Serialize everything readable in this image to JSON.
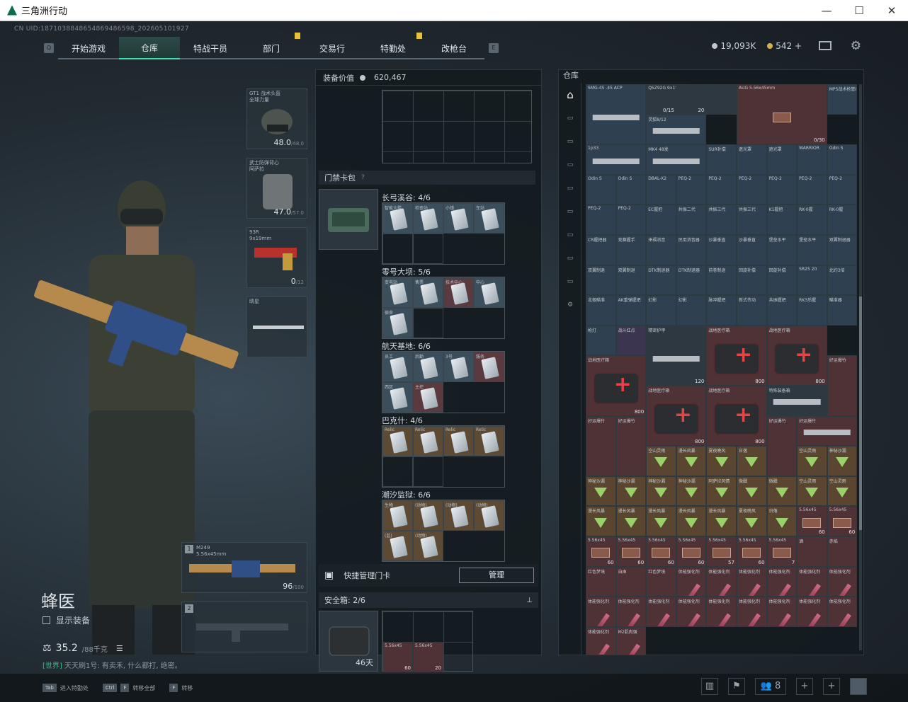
{
  "window": {
    "title": "三角洲行动",
    "minimize": "—",
    "maximize": "☐",
    "close": "✕"
  },
  "uid": "CN UID:1871038848654869486598_202605101927",
  "nav": {
    "tabs": [
      "开始游戏",
      "仓库",
      "特战干员",
      "部门",
      "交易行",
      "特勤处",
      "改枪台"
    ],
    "active": "仓库"
  },
  "currency": {
    "silver": "19,093K",
    "gold": "542",
    "plus": "+"
  },
  "operator": {
    "name": "蜂医",
    "show_gear": "显示装备",
    "weight": "35.2",
    "weight_max": "/88千克",
    "chat_tag": "[世界]",
    "chat_text": "天天刷1号: 有卖禾, 什么都打, 绝密。"
  },
  "gear": {
    "helmet": {
      "label": "GT1 战术头盔\n全球力量",
      "val": "48.0",
      "max": "/48.0"
    },
    "armor": {
      "label": "武士防弹背心\n阿萨拉",
      "val": "47.0",
      "max": "/57.0"
    },
    "pistol": {
      "label": "93R\n9x19mm",
      "val": "0",
      "max": "/12"
    },
    "melee": {
      "label": "晴星"
    },
    "primary": {
      "num": "1",
      "label": "M249\n5.56x45mm",
      "val": "96",
      "max": "/100"
    },
    "secondary": {
      "num": "2"
    }
  },
  "center": {
    "equip_value_label": "装备价值",
    "equip_value": "620,467",
    "cardbag_title": "门禁卡包",
    "maps": [
      {
        "name": "长弓溪谷: 4/6",
        "cards": [
          [
            "智能大楼",
            "blue"
          ],
          [
            "检查站",
            "blue"
          ],
          [
            "小镇",
            "blue"
          ],
          [
            "车站",
            "blue"
          ]
        ]
      },
      {
        "name": "零号大坝: 5/6",
        "cards": [
          [
            "变电站",
            "blue"
          ],
          [
            "售票",
            "blue"
          ],
          [
            "技术中心",
            "red"
          ],
          [
            "中心",
            "blue"
          ],
          [
            "宿舍",
            "blue"
          ]
        ]
      },
      {
        "name": "航天基地: 6/6",
        "cards": [
          [
            "员工",
            "blue"
          ],
          [
            "后勤",
            "blue"
          ],
          [
            "3号",
            "blue"
          ],
          [
            "服务",
            "red"
          ],
          [
            "西区",
            "blue"
          ],
          [
            "主控",
            "red"
          ]
        ]
      },
      {
        "name": "巴克什: 4/6",
        "cards": [
          [
            "Relic",
            "gold"
          ],
          [
            "Relic",
            "gold"
          ],
          [
            "Relic",
            "gold"
          ],
          [
            "Relic",
            "gold"
          ]
        ]
      },
      {
        "name": "潮汐监狱: 6/6",
        "cards": [
          [
            "生物",
            "gold"
          ],
          [
            "(动物)",
            "gold"
          ],
          [
            "(动物)",
            "gold"
          ],
          [
            "(动物)",
            "gold"
          ],
          [
            "(监)",
            "gold"
          ],
          [
            "(动物)",
            "gold"
          ]
        ]
      }
    ],
    "quick_manage": "快捷管理门卡",
    "manage_btn": "管理",
    "safebox": "安全箱: 2/6",
    "safebox_time": "46天",
    "safebox_items": [
      [
        "5.56x45",
        "60"
      ],
      [
        "5.56x45",
        "20"
      ]
    ]
  },
  "stash": {
    "title": "仓库",
    "cells": [
      [
        "SMG-45 .45 ACP",
        "",
        "blue",
        "span2"
      ],
      [
        "QSZ92G 9x19mm",
        "0/15",
        "gray",
        ""
      ],
      [
        "",
        "20",
        "gray",
        ""
      ],
      [
        "",
        "",
        "gray",
        ""
      ],
      [
        "AUG 5.56x45mm",
        "0/30",
        "red",
        "span3w"
      ],
      [
        "MP5战术枪管组合",
        "",
        "blue",
        ""
      ],
      [
        "灵狐8/12",
        "",
        "blue",
        "span2w"
      ],
      [
        "1p33",
        "",
        "blue",
        "span2w"
      ],
      [
        "MK4 48发",
        "",
        "blue",
        "span2w"
      ],
      [
        "SUR补偿",
        "",
        "blue",
        ""
      ],
      [
        "遮光罩",
        "",
        "blue",
        ""
      ],
      [
        "遮光罩",
        "",
        "blue",
        ""
      ],
      [
        "WARRIOR",
        "",
        "blue",
        ""
      ],
      [
        "Odin S",
        "",
        "blue",
        ""
      ],
      [
        "Odin S",
        "",
        "blue",
        ""
      ],
      [
        "Odin S",
        "",
        "blue",
        ""
      ],
      [
        "DBAL-X2",
        "",
        "blue",
        ""
      ],
      [
        "PEQ-2",
        "",
        "blue",
        ""
      ],
      [
        "PEQ-2",
        "",
        "blue",
        ""
      ],
      [
        "PEQ-2",
        "",
        "blue",
        ""
      ],
      [
        "PEQ-2",
        "",
        "blue",
        ""
      ],
      [
        "PEQ-2",
        "",
        "blue",
        ""
      ],
      [
        "PEQ-2",
        "",
        "blue",
        ""
      ],
      [
        "PEQ-2",
        "",
        "blue",
        ""
      ],
      [
        "PEQ-2",
        "",
        "blue",
        ""
      ],
      [
        "EC握把",
        "",
        "blue",
        ""
      ],
      [
        "共振二代",
        "",
        "blue",
        ""
      ],
      [
        "共振三代",
        "",
        "blue",
        ""
      ],
      [
        "共振三代",
        "",
        "blue",
        ""
      ],
      [
        "K1握把",
        "",
        "blue",
        ""
      ],
      [
        "RK-0握",
        "",
        "blue",
        ""
      ],
      [
        "RK-0握",
        "",
        "blue",
        ""
      ],
      [
        "CR握把器",
        "",
        "blue",
        ""
      ],
      [
        "竞赛握手",
        "",
        "blue",
        ""
      ],
      [
        "来福消音",
        "",
        "blue",
        ""
      ],
      [
        "民用消音器",
        "",
        "blue",
        ""
      ],
      [
        "沙暴垂直",
        "",
        "blue",
        ""
      ],
      [
        "沙暴垂直",
        "",
        "blue",
        ""
      ],
      [
        "堡垒水平",
        "",
        "blue",
        ""
      ],
      [
        "堡垒水平",
        "",
        "blue",
        ""
      ],
      [
        "双翼制退器",
        "",
        "blue",
        ""
      ],
      [
        "双翼制退",
        "",
        "blue",
        ""
      ],
      [
        "双翼制退",
        "",
        "blue",
        ""
      ],
      [
        "DTK制退器",
        "",
        "blue",
        ""
      ],
      [
        "DTK制退器",
        "",
        "blue",
        ""
      ],
      [
        "前卷制退",
        "",
        "blue",
        ""
      ],
      [
        "回旋补偿",
        "",
        "blue",
        ""
      ],
      [
        "回旋补偿",
        "",
        "blue",
        ""
      ],
      [
        "SR25 20",
        "",
        "blue",
        ""
      ],
      [
        "北约3倍",
        "",
        "blue",
        ""
      ],
      [
        "北极瞄准",
        "",
        "blue",
        ""
      ],
      [
        "AK重弹握把",
        "",
        "blue",
        ""
      ],
      [
        "幻影",
        "",
        "blue",
        ""
      ],
      [
        "幻影",
        "",
        "blue",
        ""
      ],
      [
        "脉冲握把",
        "",
        "blue",
        ""
      ],
      [
        "新式传动",
        "",
        "blue",
        ""
      ],
      [
        "共振握把",
        "",
        "blue",
        ""
      ],
      [
        "RK3后握",
        "",
        "blue",
        ""
      ],
      [
        "瞄准器",
        "",
        "blue",
        ""
      ],
      [
        "枪灯",
        "",
        "blue",
        ""
      ],
      [
        "战斗红点",
        "",
        "purple",
        ""
      ],
      [
        "精密护甲",
        "120",
        "gray",
        "span2"
      ],
      [
        "战地医疗箱",
        "800",
        "red",
        "span2"
      ],
      [
        "战地医疗箱",
        "800",
        "red",
        "span2"
      ],
      [
        "战地医疗箱",
        "800",
        "red",
        "span2"
      ],
      [
        "好运爆竹",
        "",
        "red",
        "span1t"
      ],
      [
        "战地医疗箱",
        "800",
        "red",
        "span2"
      ],
      [
        "战地医疗箱",
        "800",
        "red",
        "span2"
      ],
      [
        "特殊装备箱",
        "",
        "gray",
        "span2w"
      ],
      [
        "好运爆竹",
        "",
        "red",
        "span1t"
      ],
      [
        "好运爆竹",
        "",
        "red",
        "span1t"
      ],
      [
        "好运爆竹",
        "",
        "red",
        "span1t"
      ],
      [
        "好运爆竹",
        "",
        "red",
        "span2w"
      ],
      [
        "空山灵雨",
        "",
        "gold",
        ""
      ],
      [
        "漫长风暴",
        "",
        "gold",
        ""
      ],
      [
        "夏夜晚风",
        "",
        "gold",
        ""
      ],
      [
        "日落",
        "",
        "gold",
        ""
      ],
      [
        "空山灵雨",
        "",
        "gold",
        ""
      ],
      [
        "神秘沙漏",
        "",
        "gold",
        ""
      ],
      [
        "神秘沙漏",
        "",
        "gold",
        ""
      ],
      [
        "神秘沙漏",
        "",
        "gold",
        ""
      ],
      [
        "神秘沙漏",
        "",
        "gold",
        ""
      ],
      [
        "神秘沙漏",
        "",
        "gold",
        ""
      ],
      [
        "阿萨拉风情",
        "",
        "gold",
        ""
      ],
      [
        "微醺",
        "",
        "gold",
        ""
      ],
      [
        "微醺",
        "",
        "gold",
        ""
      ],
      [
        "空山灵雨",
        "",
        "gold",
        ""
      ],
      [
        "空山灵雨",
        "",
        "gold",
        ""
      ],
      [
        "漫长风暴",
        "",
        "gold",
        ""
      ],
      [
        "漫长风暴",
        "",
        "gold",
        ""
      ],
      [
        "漫长风暴",
        "",
        "gold",
        ""
      ],
      [
        "漫长风暴",
        "",
        "gold",
        ""
      ],
      [
        "漫长风暴",
        "",
        "gold",
        ""
      ],
      [
        "夏夜晚风",
        "",
        "gold",
        ""
      ],
      [
        "日落",
        "",
        "gold",
        ""
      ],
      [
        "5.56x45",
        "60",
        "red",
        ""
      ],
      [
        "5.56x45",
        "60",
        "red",
        ""
      ],
      [
        "5.56x45",
        "60",
        "red",
        ""
      ],
      [
        "5.56x45",
        "60",
        "red",
        ""
      ],
      [
        "5.56x45",
        "60",
        "red",
        ""
      ],
      [
        "5.56x45",
        "60",
        "red",
        ""
      ],
      [
        "5.56x45",
        "57",
        "red",
        ""
      ],
      [
        "5.56x45",
        "60",
        "red",
        ""
      ],
      [
        "5.56x45",
        "7",
        "red",
        ""
      ],
      [
        "酒",
        "",
        "red",
        ""
      ],
      [
        "赤焰",
        "",
        "red",
        ""
      ],
      [
        "红色梦境",
        "",
        "red",
        ""
      ],
      [
        "自由",
        "",
        "red",
        ""
      ],
      [
        "红色梦境",
        "",
        "red",
        ""
      ],
      [
        "体能强化剂",
        "",
        "red",
        ""
      ],
      [
        "体能强化剂",
        "",
        "red",
        ""
      ],
      [
        "体能强化剂",
        "",
        "red",
        ""
      ],
      [
        "体能强化剂",
        "",
        "red",
        ""
      ],
      [
        "体能强化剂",
        "",
        "red",
        ""
      ],
      [
        "体能强化剂",
        "",
        "red",
        ""
      ],
      [
        "体能强化剂",
        "",
        "red",
        ""
      ],
      [
        "体能强化剂",
        "",
        "red",
        ""
      ],
      [
        "体能强化剂",
        "",
        "red",
        ""
      ],
      [
        "体能强化剂",
        "",
        "red",
        ""
      ],
      [
        "体能强化剂",
        "",
        "red",
        ""
      ],
      [
        "体能强化剂",
        "",
        "red",
        ""
      ],
      [
        "体能强化剂",
        "",
        "red",
        ""
      ],
      [
        "体能强化剂",
        "",
        "red",
        ""
      ],
      [
        "体能强化剂",
        "",
        "red",
        ""
      ],
      [
        "体能强化剂",
        "",
        "red",
        ""
      ],
      [
        "M2肌肉强",
        "",
        "red",
        ""
      ]
    ]
  },
  "bottom": {
    "hints": [
      [
        "Tab",
        "进入特勤处"
      ],
      [
        "Ctrl",
        "F",
        "转移全部"
      ],
      [
        "F",
        "转移"
      ]
    ],
    "friends_count": "8"
  },
  "colors": {
    "accent": "#3fe0b0",
    "notif": "#e8c03a"
  },
  "icons": {
    "mail": "mail-icon",
    "settings": "gear-icon",
    "stash": "stash-icon",
    "lock": "lock-icon",
    "swap": "swap-icon",
    "pin": "pin-icon"
  }
}
